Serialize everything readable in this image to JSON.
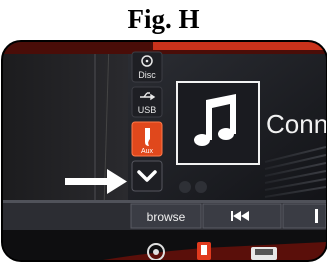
{
  "figure": {
    "caption": "Fig. H"
  },
  "side_buttons": {
    "disc": {
      "label": "Disc",
      "icon": "disc-icon"
    },
    "usb": {
      "label": "USB",
      "icon": "usb-icon"
    },
    "aux": {
      "label": "Aux",
      "icon": "aux-jack-icon",
      "color": "#e0481c"
    },
    "expand": {
      "icon": "chevron-down-icon"
    }
  },
  "main": {
    "album_art_icon": "music-note-icon",
    "title_partial": "Conn"
  },
  "controls": {
    "browse_label": "browse",
    "previous_icon": "skip-previous-icon"
  },
  "annotation": {
    "arrow_icon": "white-arrow-icon",
    "arrow_color": "#ffffff"
  },
  "colors": {
    "accent_red": "#e03a1e",
    "screen_bg": "#0c0c0e"
  }
}
